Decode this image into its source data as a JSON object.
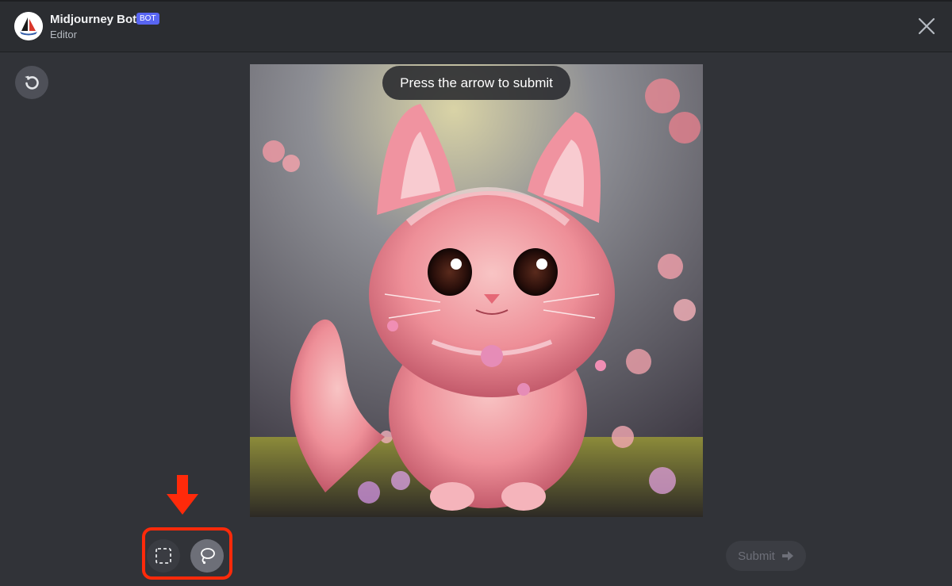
{
  "header": {
    "bot_name": "Midjourney Bot",
    "badge": "BOT",
    "subtitle": "Editor"
  },
  "tooltip": {
    "text": "Press the arrow to submit"
  },
  "footer": {
    "submit_label": "Submit"
  },
  "icons": {
    "close": "close-icon",
    "undo": "undo-icon",
    "rect_select": "rectangle-select-icon",
    "lasso": "lasso-icon",
    "arrow": "arrow-right-icon"
  },
  "colors": {
    "background": "#313338",
    "header_bg": "#2b2d31",
    "badge": "#5865f2",
    "annotation": "#ff2a0a"
  }
}
